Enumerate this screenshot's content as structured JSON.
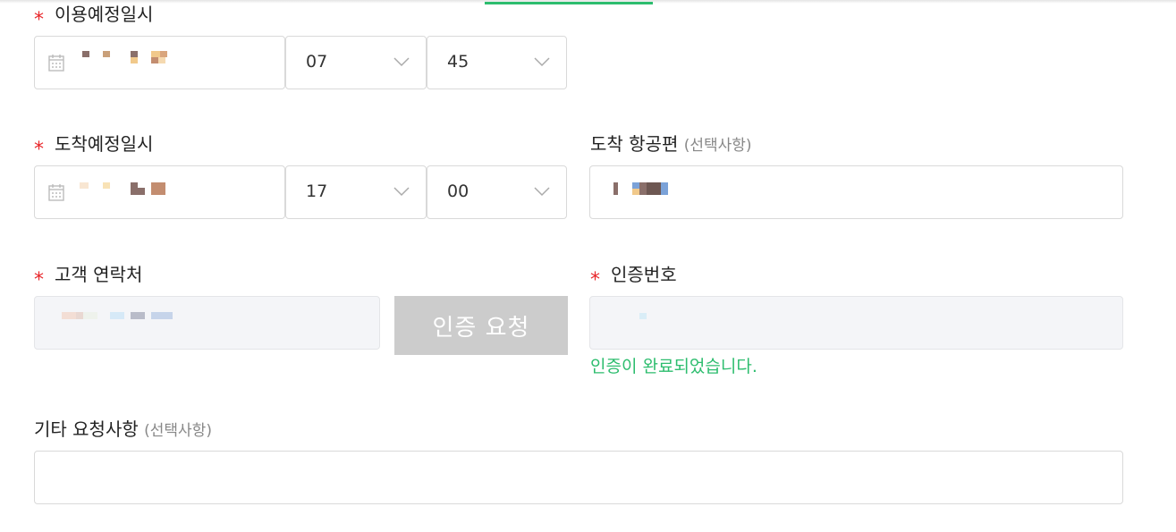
{
  "required_mark": "*",
  "optional_text": "(선택사항)",
  "departure": {
    "label": "이용예정일시",
    "hour": "07",
    "minute": "45"
  },
  "arrival": {
    "label": "도착예정일시",
    "hour": "17",
    "minute": "00"
  },
  "flight": {
    "label": "도착 항공편"
  },
  "contact": {
    "label": "고객 연락처",
    "request_button": "인증 요청"
  },
  "auth": {
    "label": "인증번호",
    "success_message": "인증이 완료되었습니다."
  },
  "notes": {
    "label": "기타 요청사항",
    "value": ""
  },
  "colors": {
    "accent_green": "#2dbd6e",
    "required_red": "#e8262a",
    "disabled_button": "#cccccc"
  },
  "icons": {
    "calendar": "calendar-icon",
    "dropdown": "chevron-down-icon"
  }
}
